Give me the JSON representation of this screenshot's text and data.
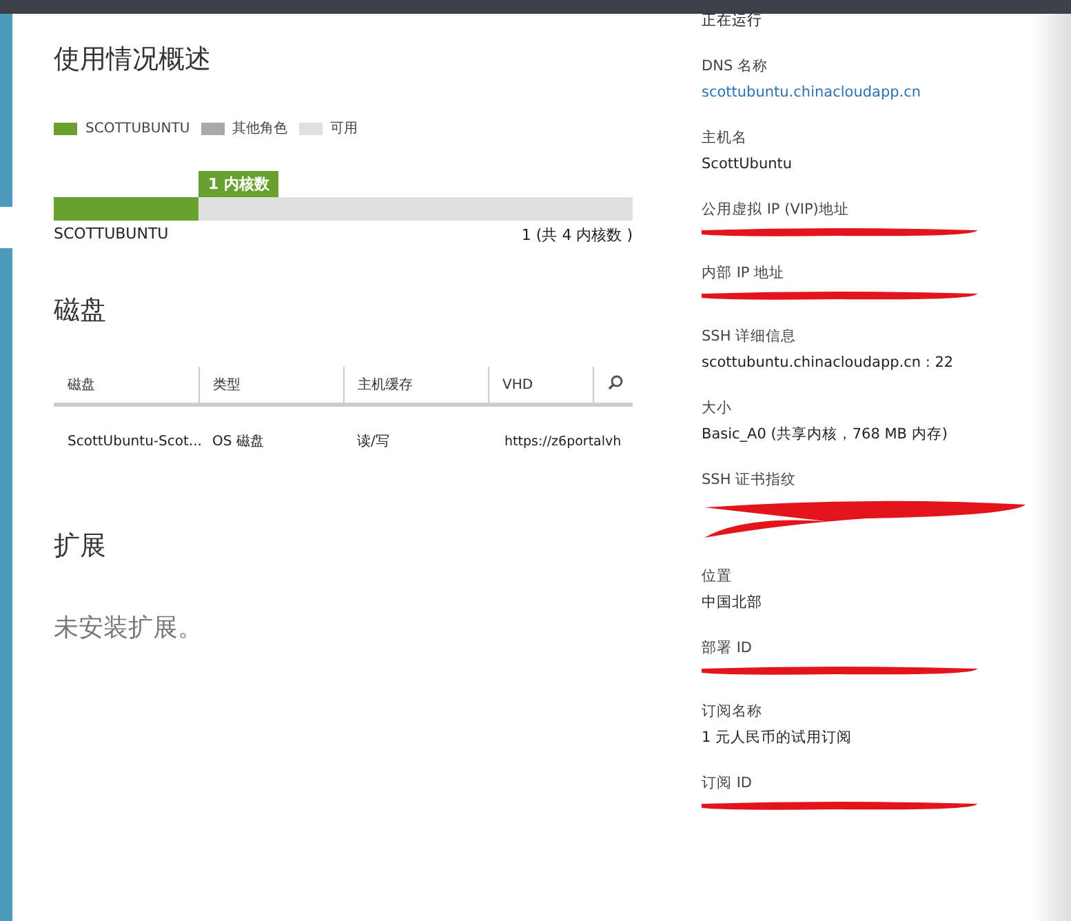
{
  "usage": {
    "title": "使用情况概述",
    "legend": [
      {
        "label": "SCOTTUBUNTU",
        "color": "#68a12f"
      },
      {
        "label": "其他角色",
        "color": "#a9a9a9"
      },
      {
        "label": "可用",
        "color": "#e0e0e0"
      }
    ],
    "callout": "1 内核数",
    "level": 0.25,
    "bar_label": "SCOTTUBUNTU",
    "bar_reading": "1 (共 4 内核数 )"
  },
  "disks": {
    "title": "磁盘",
    "columns": [
      "磁盘",
      "类型",
      "主机缓存",
      "VHD"
    ],
    "rows": [
      [
        "ScottUbuntu-Scot...",
        "OS 磁盘",
        "读/写",
        "https://z6portalvh"
      ]
    ]
  },
  "extensions": {
    "title": "扩展",
    "empty_text": "未安装扩展。"
  },
  "properties": [
    {
      "kind": "text",
      "value": "正在运行"
    },
    {
      "kind": "link",
      "label": "DNS 名称",
      "value": "scottubuntu.chinacloudapp.cn"
    },
    {
      "kind": "text",
      "label": "主机名",
      "value": "ScottUbuntu"
    },
    {
      "kind": "redacted",
      "label": "公用虚拟 IP (VIP)地址"
    },
    {
      "kind": "redacted",
      "label": "内部 IP 地址"
    },
    {
      "kind": "text",
      "label": "SSH 详细信息",
      "value": "scottubuntu.chinacloudapp.cn : 22"
    },
    {
      "kind": "text",
      "label": "大小",
      "value": "Basic_A0 (共享内核，768 MB 内存)"
    },
    {
      "kind": "redacted_tall",
      "label": "SSH 证书指纹"
    },
    {
      "kind": "text",
      "label": "位置",
      "value": "中国北部"
    },
    {
      "kind": "redacted",
      "label": "部署 ID"
    },
    {
      "kind": "text",
      "label": "订阅名称",
      "value": "1 元人民币的试用订阅"
    },
    {
      "kind": "redacted",
      "label": "订阅 ID"
    }
  ]
}
